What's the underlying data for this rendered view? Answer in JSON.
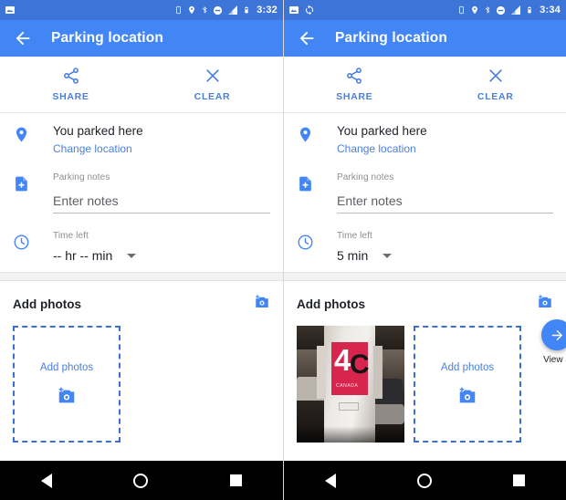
{
  "screens": [
    {
      "id": "left",
      "statusbar": {
        "left_icons": [
          "image-icon"
        ],
        "right_icons": [
          "vibrate-icon",
          "location-icon",
          "bluetooth-icon",
          "do-not-disturb-icon",
          "signal-icon",
          "battery-icon"
        ],
        "time": "3:32"
      },
      "appbar": {
        "back_icon": "back-arrow-icon",
        "title": "Parking location"
      },
      "actions": [
        {
          "icon": "share-icon",
          "label": "SHARE"
        },
        {
          "icon": "close-icon",
          "label": "CLEAR"
        }
      ],
      "location_row": {
        "icon": "map-pin-icon",
        "title": "You parked here",
        "link": "Change location"
      },
      "notes_row": {
        "icon": "add-note-icon",
        "label": "Parking notes",
        "placeholder": "Enter notes",
        "value": ""
      },
      "time_row": {
        "icon": "clock-icon",
        "label": "Time left",
        "value": "-- hr -- min",
        "caret_icon": "chevron-down-icon"
      },
      "photos": {
        "title": "Add photos",
        "add_icon": "add-a-photo-icon",
        "placeholder_label": "Add photos",
        "placeholder_icon": "add-a-photo-icon",
        "has_thumbnail": false,
        "thumbnail_sign_number": "",
        "thumbnail_sign_letter": "",
        "thumbnail_caption": "",
        "fab_visible": false,
        "fab_icon": "",
        "fab_label": ""
      },
      "navbar": {
        "back_icon": "nav-back-icon",
        "home_icon": "nav-home-icon",
        "recents_icon": "nav-recents-icon"
      }
    },
    {
      "id": "right",
      "statusbar": {
        "left_icons": [
          "image-icon",
          "sync-icon"
        ],
        "right_icons": [
          "vibrate-icon",
          "location-icon",
          "bluetooth-icon",
          "do-not-disturb-icon",
          "signal-icon",
          "battery-icon"
        ],
        "time": "3:34"
      },
      "appbar": {
        "back_icon": "back-arrow-icon",
        "title": "Parking location"
      },
      "actions": [
        {
          "icon": "share-icon",
          "label": "SHARE"
        },
        {
          "icon": "close-icon",
          "label": "CLEAR"
        }
      ],
      "location_row": {
        "icon": "map-pin-icon",
        "title": "You parked here",
        "link": "Change location"
      },
      "notes_row": {
        "icon": "add-note-icon",
        "label": "Parking notes",
        "placeholder": "Enter notes",
        "value": ""
      },
      "time_row": {
        "icon": "clock-icon",
        "label": "Time left",
        "value": "5 min",
        "caret_icon": "chevron-down-icon"
      },
      "photos": {
        "title": "Add photos",
        "add_icon": "add-a-photo-icon",
        "placeholder_label": "Add photos",
        "placeholder_icon": "add-a-photo-icon",
        "has_thumbnail": true,
        "thumbnail_sign_number": "4",
        "thumbnail_sign_letter": "C",
        "thumbnail_caption": "CANADA",
        "fab_visible": true,
        "fab_icon": "arrow-right-icon",
        "fab_label": "View a"
      },
      "navbar": {
        "back_icon": "nav-back-icon",
        "home_icon": "nav-home-icon",
        "recents_icon": "nav-recents-icon"
      }
    }
  ],
  "colors": {
    "appbar_blue": "#4285f4",
    "statusbar_blue": "#3d74d8",
    "accent_blue": "#4a7fe0",
    "dashed_blue": "#3a6fd8",
    "text_primary": "#20232a",
    "text_secondary": "#8a8d91",
    "navbar_black": "#000000",
    "sign_red": "#d8254e"
  }
}
